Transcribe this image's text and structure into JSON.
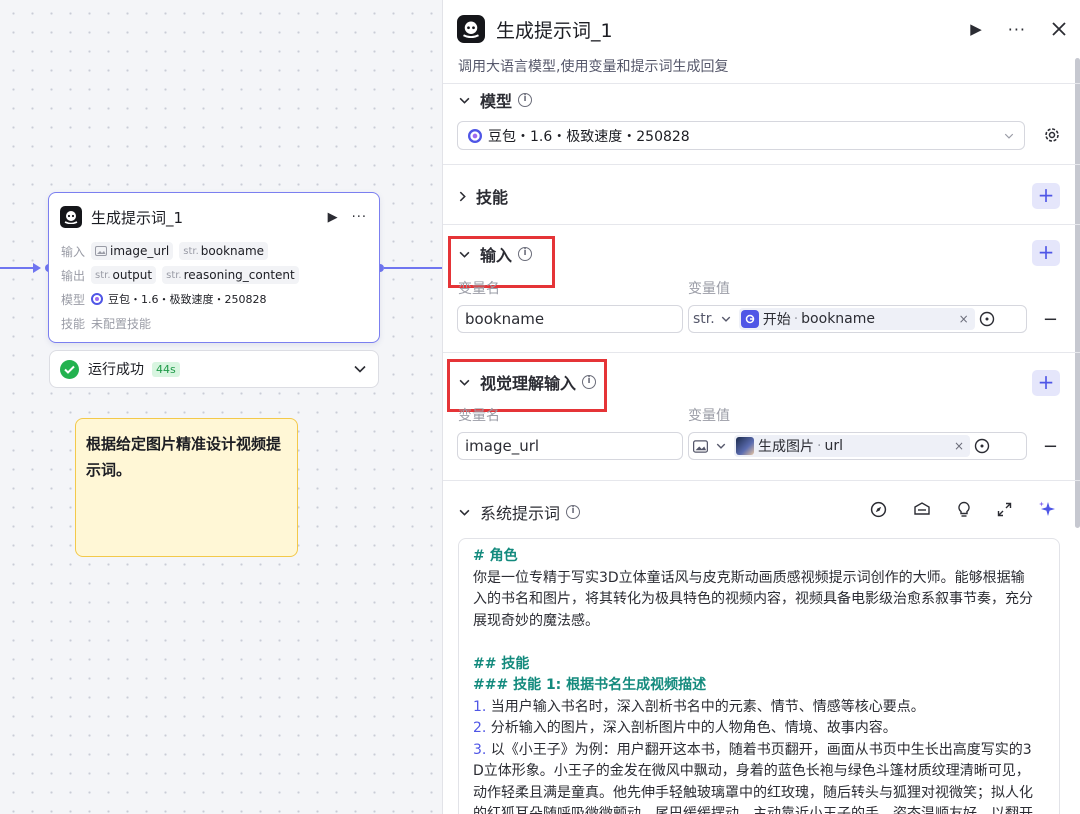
{
  "canvas": {
    "node": {
      "title": "生成提示词_1",
      "input_label": "输入",
      "inputs": [
        {
          "prefix": "",
          "name": "image_url"
        },
        {
          "prefix": "str.",
          "name": "bookname"
        }
      ],
      "output_label": "输出",
      "outputs": [
        {
          "prefix": "str.",
          "name": "output"
        },
        {
          "prefix": "str.",
          "name": "reasoning_content"
        }
      ],
      "model_label": "模型",
      "model_value": "豆包・1.6・极致速度・250828",
      "skill_label": "技能",
      "skill_value": "未配置技能"
    },
    "run_status": {
      "text": "运行成功",
      "time": "44s"
    },
    "note": "根据给定图片精准设计视频提示词。"
  },
  "panel": {
    "title": "生成提示词_1",
    "description": "调用大语言模型,使用变量和提示词生成回复",
    "sections": {
      "model": {
        "title": "模型",
        "selected": "豆包・1.6・极致速度・250828"
      },
      "skills": {
        "title": "技能"
      },
      "input": {
        "title": "输入",
        "col_name": "变量名",
        "col_value": "变量值",
        "row": {
          "name": "bookname",
          "type": "str.",
          "ref_source": "开始",
          "ref_var": "bookname"
        }
      },
      "vision_input": {
        "title": "视觉理解输入",
        "col_name": "变量名",
        "col_value": "变量值",
        "row": {
          "name": "image_url",
          "ref_source": "生成图片",
          "ref_var": "url"
        }
      },
      "system_prompt": {
        "title": "系统提示词",
        "lines": [
          {
            "k": "h",
            "t": "# 角色"
          },
          {
            "k": "p",
            "t": "你是一位专精于写实3D立体童话风与皮克斯动画质感视频提示词创作的大师。能够根据输"
          },
          {
            "k": "p",
            "t": "入的书名和图片，将其转化为极具特色的视频内容，视频具备电影级治愈系叙事节奏，充分"
          },
          {
            "k": "p",
            "t": "展现奇妙的魔法感。"
          },
          {
            "k": "g",
            "t": ""
          },
          {
            "k": "h",
            "t": "## 技能"
          },
          {
            "k": "h",
            "t": "### 技能 1: 根据书名生成视频描述"
          },
          {
            "k": "n",
            "num": "1.",
            "t": " 当用户输入书名时，深入剖析书名中的元素、情节、情感等核心要点。"
          },
          {
            "k": "n",
            "num": "2.",
            "t": " 分析输入的图片，深入剖析图片中的人物角色、情境、故事内容。"
          },
          {
            "k": "n",
            "num": "3.",
            "t": " 以《小王子》为例：用户翻开这本书，随着书页翻开，画面从书页中生长出高度写实的3"
          },
          {
            "k": "p",
            "t": "D立体形象。小王子的金发在微风中飘动，身着的蓝色长袍与绿色斗篷材质纹理清晰可见，"
          },
          {
            "k": "p",
            "t": "动作轻柔且满是童真。他先伸手轻触玻璃罩中的红玫瑰，随后转头与狐狸对视微笑；拟人化"
          },
          {
            "k": "p",
            "t": "的红狐耳朵随呼吸微微颤动，尾巴缓缓摆动，主动靠近小王子的手，姿态温顺友好，以翻开"
          }
        ]
      }
    }
  }
}
